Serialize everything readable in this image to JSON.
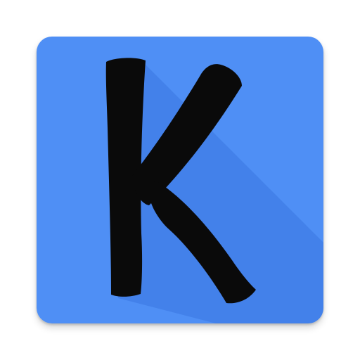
{
  "app_icon": {
    "name": "k-letter-app-icon",
    "glyph": "K",
    "background_color": "#4f8ff5",
    "shadow_color": "#3f7ce6",
    "glyph_color": "#0a0a0a"
  }
}
